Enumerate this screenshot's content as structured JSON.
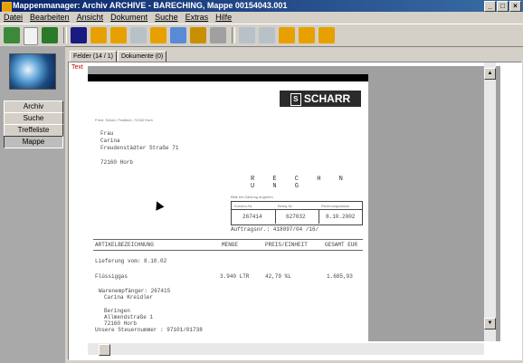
{
  "window": {
    "title": "Mappenmanager: Archiv ARCHIVE - BARECHING, Mappe 00154043.001"
  },
  "menu": [
    "Datei",
    "Bearbeiten",
    "Ansicht",
    "Dokument",
    "Suche",
    "Extras",
    "Hilfe"
  ],
  "nav": [
    "Archiv",
    "Suche",
    "Treffeliste",
    "Mappe"
  ],
  "nav_active": "Mappe",
  "tabs": [
    "Felder (14 / 1)",
    "Dokumente (0)"
  ],
  "content": {
    "text_label": "Text"
  },
  "document": {
    "company": "SCHARR",
    "sender_line": "Fried. Scharr, Postfach, 72160 Horb",
    "recipient": [
      "Frau",
      "Carina",
      "Freudenstädter Straße 71",
      "",
      "72160 Horb"
    ],
    "invoice_word": "R E C H N U N G",
    "ref_header": "Bitte bei Zahlung angeben",
    "ref_cols": [
      "Kunden-Nr.",
      "Beleg-Nr.",
      "Rechnungsdatum"
    ],
    "ref_values": [
      "267414",
      "627032",
      "8.10.2002"
    ],
    "auftrag": "Auftragsnr.: 418097/04 /16/",
    "col_headers": [
      "ARTIKELBEZEICHNUNG",
      "MENGE",
      "PREIS/EINHEIT",
      "GESAMT EUR"
    ],
    "lines": {
      "lieferung": "Lieferung vom:  8.10.02",
      "item_name": "Flüssiggas",
      "item_qty": "3.940 LTR",
      "item_price": "42,79 %L",
      "item_total": "1.685,93",
      "recipient_label": "Warenempfänger:  267415",
      "recipient_name": "Carina Kreidler",
      "addr1": "Beringen",
      "addr2": "Allmendstraße 1",
      "addr3": "72160 Horb",
      "tax": "Unsere Steuernummer : 97101/01738"
    }
  }
}
